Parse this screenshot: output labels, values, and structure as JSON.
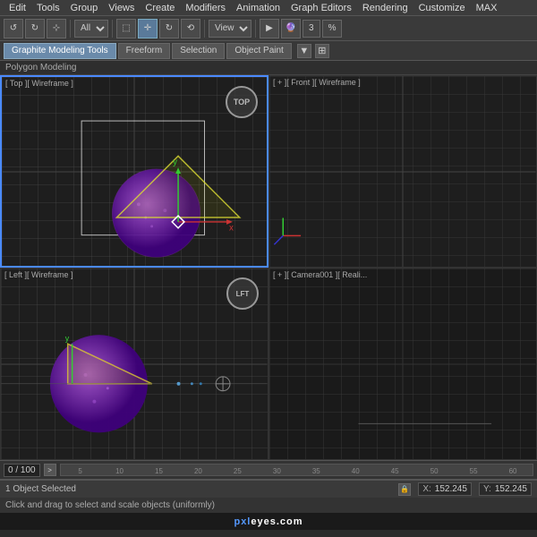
{
  "menubar": {
    "items": [
      "Edit",
      "Tools",
      "Group",
      "Views",
      "Create",
      "Modifiers",
      "Animation",
      "Graph Editors",
      "Rendering",
      "Customize",
      "MAX"
    ]
  },
  "toolbar": {
    "dropdown_all": "All",
    "dropdown_view": "View"
  },
  "modeling_bar": {
    "title": "Graphite Modeling Tools",
    "tabs": [
      "Freeform",
      "Selection",
      "Object Paint"
    ]
  },
  "poly_modeling": {
    "label": "Polygon Modeling"
  },
  "viewports": [
    {
      "label": "[ Top ][ Wireframe ]",
      "position": "top-left",
      "active": true
    },
    {
      "label": "+ ][ Front ][ Wireframe ]",
      "position": "top-right",
      "active": false
    },
    {
      "label": "[ Left ][ Wireframe ]",
      "position": "bottom-left",
      "active": false
    },
    {
      "label": "+ ][ Camera001 ][ Reali",
      "position": "bottom-right",
      "active": false
    }
  ],
  "timeline": {
    "counter": "0 / 100",
    "arrow_label": ">"
  },
  "status": {
    "selected_text": "1 Object Selected",
    "lock_icon": "🔒",
    "x_label": "X:",
    "x_value": "152.245",
    "y_label": "Y:",
    "y_value": "152.245"
  },
  "message": {
    "text": "Click and drag to select and scale objects (uniformly)"
  },
  "ruler": {
    "marks": [
      "5",
      "10",
      "15",
      "20",
      "25",
      "30",
      "35",
      "40",
      "45",
      "50",
      "55",
      "60"
    ]
  },
  "brand": {
    "text": "pxleyes.com"
  }
}
